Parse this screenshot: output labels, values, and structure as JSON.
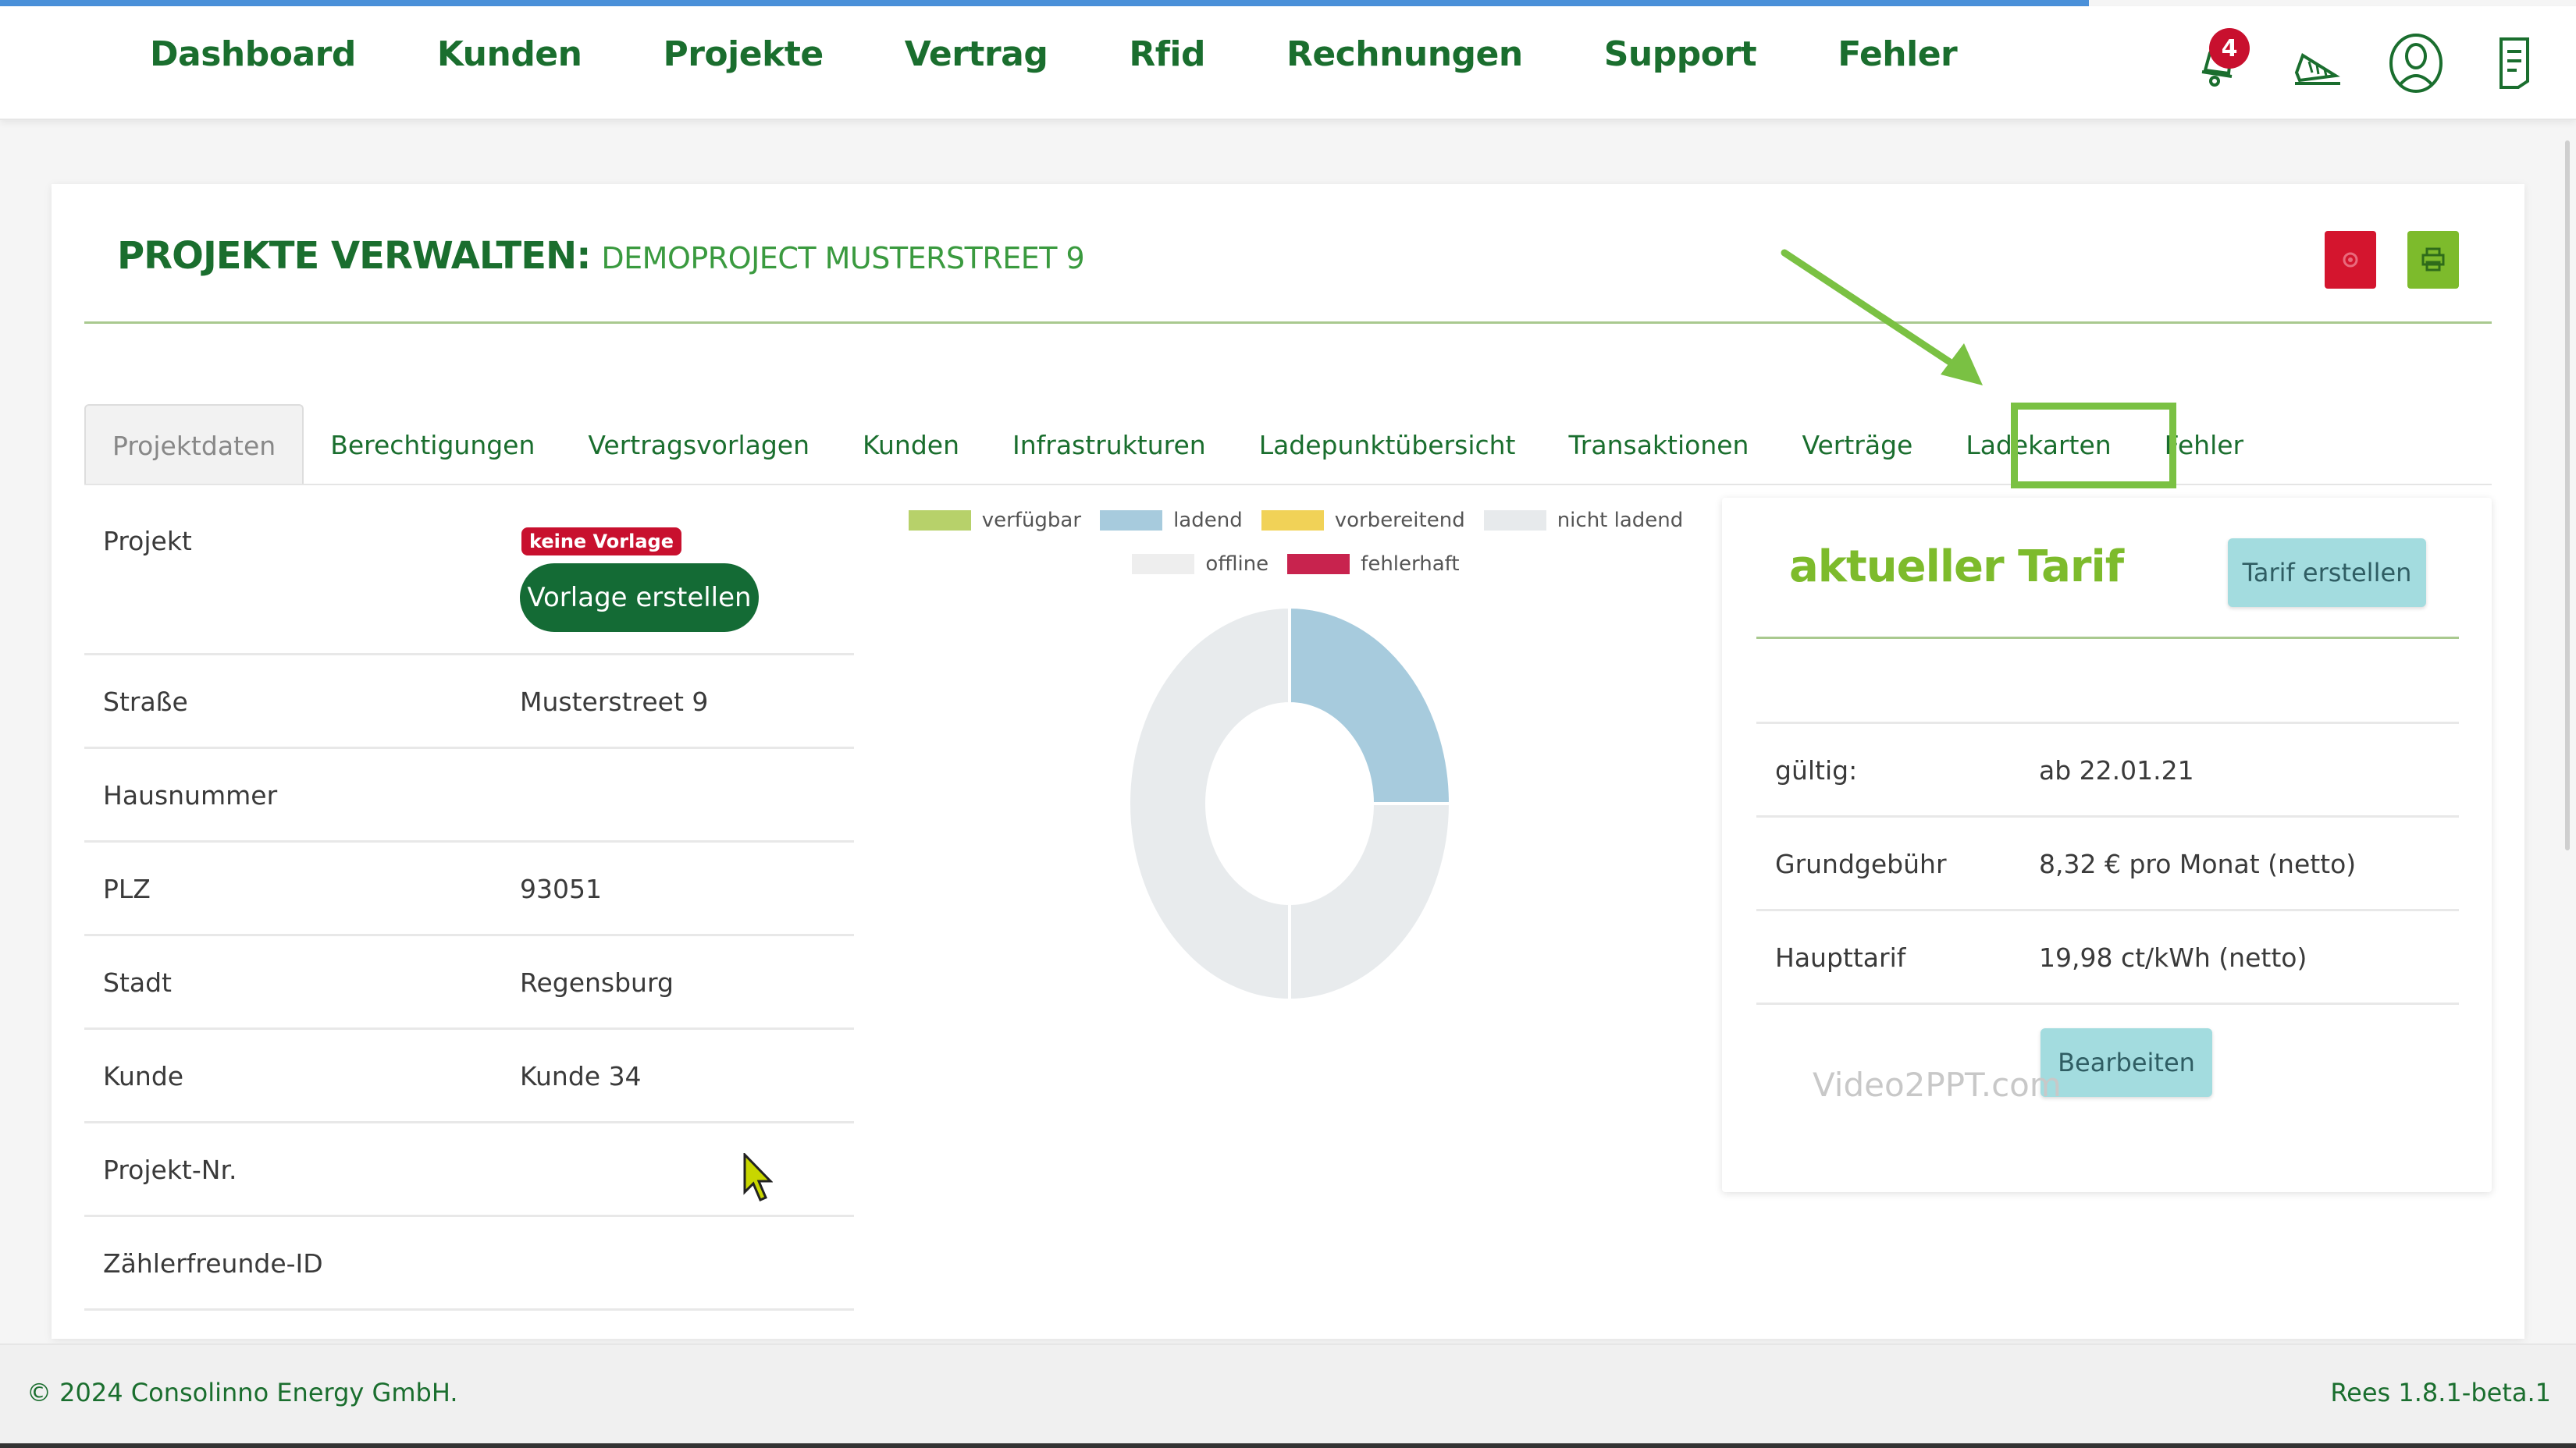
{
  "nav": {
    "items": [
      "Dashboard",
      "Kunden",
      "Projekte",
      "Vertrag",
      "Rfid",
      "Rechnungen",
      "Support",
      "Fehler"
    ],
    "notification_count": "4",
    "icons": [
      "bell-icon",
      "megaphone-icon",
      "user-icon",
      "document-icon"
    ]
  },
  "page": {
    "title_main": "PROJEKTE VERWALTEN:",
    "title_sub": "DEMOPROJECT MUSTERSTREET 9"
  },
  "tabs": [
    "Projektdaten",
    "Berechtigungen",
    "Vertragsvorlagen",
    "Kunden",
    "Infrastrukturen",
    "Ladepunktübersicht",
    "Transaktionen",
    "Verträge",
    "Ladekarten",
    "Fehler"
  ],
  "active_tab": "Projektdaten",
  "highlighted_tab": "Fehler",
  "project": {
    "badge": "keine Vorlage",
    "create_template_button": "Vorlage erstellen",
    "rows": [
      {
        "label": "Projekt",
        "value": ""
      },
      {
        "label": "Straße",
        "value": "Musterstreet 9"
      },
      {
        "label": "Hausnummer",
        "value": ""
      },
      {
        "label": "PLZ",
        "value": "93051"
      },
      {
        "label": "Stadt",
        "value": "Regensburg"
      },
      {
        "label": "Kunde",
        "value": "Kunde 34"
      },
      {
        "label": "Projekt-Nr.",
        "value": ""
      },
      {
        "label": "Zählerfreunde-ID",
        "value": ""
      }
    ]
  },
  "legend": [
    {
      "label": "verfügbar",
      "color": "#b7d16a"
    },
    {
      "label": "ladend",
      "color": "#a7cbdd"
    },
    {
      "label": "vorbereitend",
      "color": "#f1d257"
    },
    {
      "label": "nicht ladend",
      "color": "#e7eaec"
    },
    {
      "label": "offline",
      "color": "#eeeeee"
    },
    {
      "label": "fehlerhaft",
      "color": "#c8234e"
    }
  ],
  "chart_data": {
    "type": "pie",
    "categories": [
      "ladend",
      "nicht ladend",
      "offline"
    ],
    "values": [
      1,
      1,
      2
    ],
    "colors": [
      "#a7cbdd",
      "#e8ebed",
      "#e8ebed"
    ]
  },
  "tarif": {
    "title": "aktueller Tarif",
    "create_button": "Tarif erstellen",
    "rows": [
      {
        "label": "gültig:",
        "value": "ab 22.01.21"
      },
      {
        "label": "Grundgebühr",
        "value": "8,32 € pro Monat (netto)"
      },
      {
        "label": "Haupttarif",
        "value": "19,98 ct/kWh (netto)"
      }
    ],
    "edit_button": "Bearbeiten"
  },
  "watermark": "Video2PPT.com",
  "footer": {
    "copyright": "© 2024 Consolinno Energy GmbH.",
    "version": "Rees 1.8.1-beta.1"
  },
  "colors": {
    "brand_dark_green": "#1a6e2e",
    "brand_light_green": "#7dbb2c",
    "alert_red": "#c8102e",
    "highlight_green": "#7ac143"
  }
}
